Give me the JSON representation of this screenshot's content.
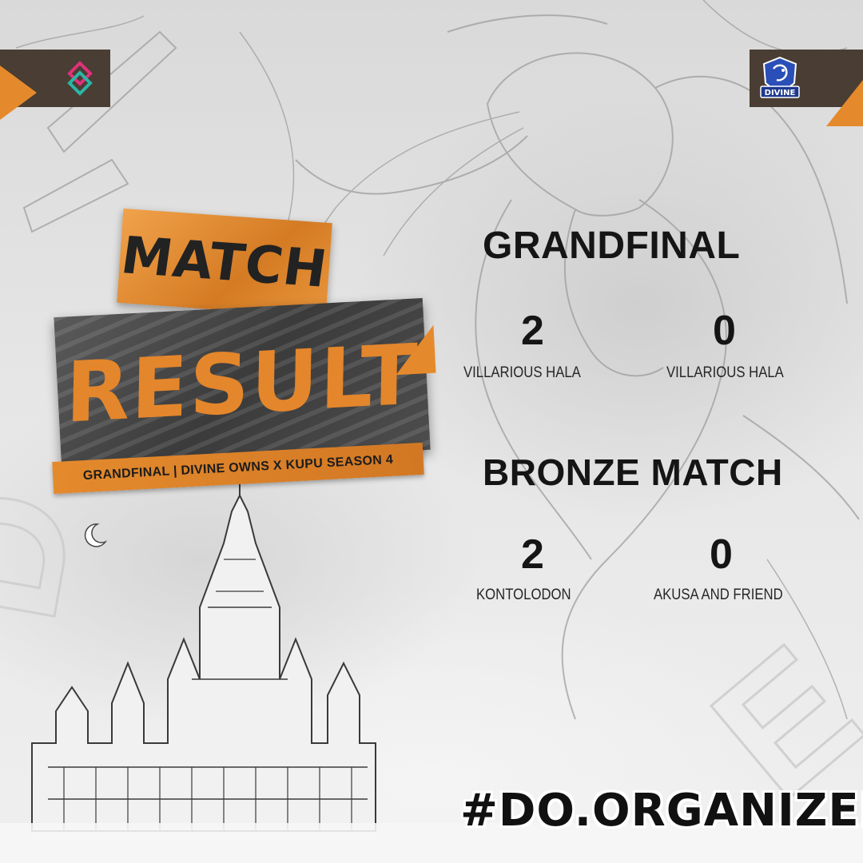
{
  "badge": {
    "match_label": "MATCH",
    "result_label": "RESULT",
    "subtitle": "GRANDFINAL | DIVINE OWNS X KUPU SEASON 4"
  },
  "grandfinal": {
    "title": "GRANDFINAL",
    "left_score": "2",
    "left_team": "VILLARIOUS HALA",
    "right_score": "0",
    "right_team": "VILLARIOUS HALA"
  },
  "bronze": {
    "title": "BRONZE MATCH",
    "left_score": "2",
    "left_team": "KONTOLODON",
    "right_score": "0",
    "right_team": "AKUSA AND FRIEND"
  },
  "hashtag": "#DO.ORGANIZER",
  "right_logo": {
    "label": "DIVINE"
  },
  "colors": {
    "accent_orange": "#e58a2c",
    "dark_brown": "#4a3d33",
    "dark_gray": "#3b3b3b",
    "logo_blue": "#2a4fb8",
    "logo_pink": "#e0317a",
    "logo_teal": "#2bb6a6"
  },
  "icons": [
    "organizer-logo-icon",
    "divine-team-logo-icon"
  ]
}
